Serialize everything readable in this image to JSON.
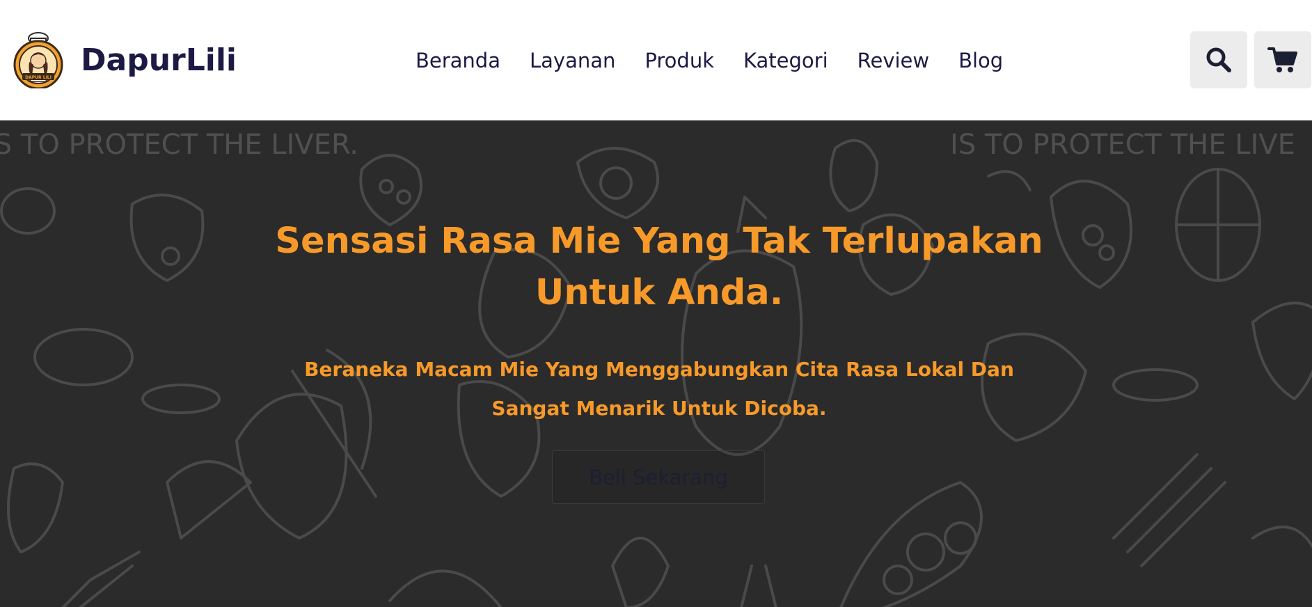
{
  "header": {
    "brand": {
      "name": "DapurLili",
      "logo_icon": "chef-logo-icon",
      "logo_text": "DAPUR LILI"
    },
    "nav": {
      "items": [
        {
          "label": "Beranda"
        },
        {
          "label": "Layanan"
        },
        {
          "label": "Produk"
        },
        {
          "label": "Kategori"
        },
        {
          "label": "Review"
        },
        {
          "label": "Blog"
        }
      ]
    },
    "actions": {
      "search_icon": "search-icon",
      "cart_icon": "cart-icon"
    }
  },
  "hero": {
    "title": "Sensasi Rasa Mie Yang Tak Terlupakan Untuk Anda.",
    "subtitle": "Beraneka Macam Mie Yang Menggabungkan Cita Rasa Lokal Dan Sangat Menarik Untuk Dicoba.",
    "cta_label": "Beli Sekarang",
    "background_texts": [
      "IS TO PROTECT THE LIVER.",
      "IS TO PROTECT THE LIVE"
    ]
  },
  "colors": {
    "accent": "#f79a29",
    "brand_text": "#1c1a44",
    "hero_background": "#2a2a2a",
    "icon_button_bg": "#ececec"
  }
}
